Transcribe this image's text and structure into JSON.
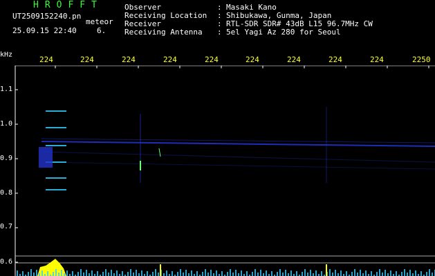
{
  "header": {
    "app_title": "HROFFT",
    "file_name": "UT2509152240.pn",
    "event_type": "meteor",
    "timestamp": "25.09.15 22:40",
    "count": "6."
  },
  "station": {
    "rows": [
      {
        "label": "Observer",
        "sep": ":",
        "value": "Masaki Kano"
      },
      {
        "label": "Receiving Location",
        "sep": ":",
        "value": "Shibukawa, Gunma, Japan"
      },
      {
        "label": "Receiver",
        "sep": ":",
        "value": "RTL-SDR SDR# 43dB L15 96.7MHz CW"
      },
      {
        "label": "Receiving Antenna",
        "sep": ":",
        "value": "5el Yagi Az 280 for Seoul"
      }
    ]
  },
  "axis": {
    "y_unit": "kHz",
    "y_ticks": [
      "1.1",
      "1.0",
      "0.9",
      "0.8",
      "0.7",
      "0.6"
    ],
    "x_ticks": [
      "224",
      "224",
      "224",
      "224",
      "224",
      "224",
      "224",
      "224",
      "224",
      "2250"
    ]
  },
  "colors": {
    "background": "#000000",
    "axis_text": "#ffffff",
    "time_labels": "#ffff33",
    "title": "#33ff33",
    "trace": "#2233cc",
    "signal": "#33ccff",
    "bars": "#ffff00"
  }
}
